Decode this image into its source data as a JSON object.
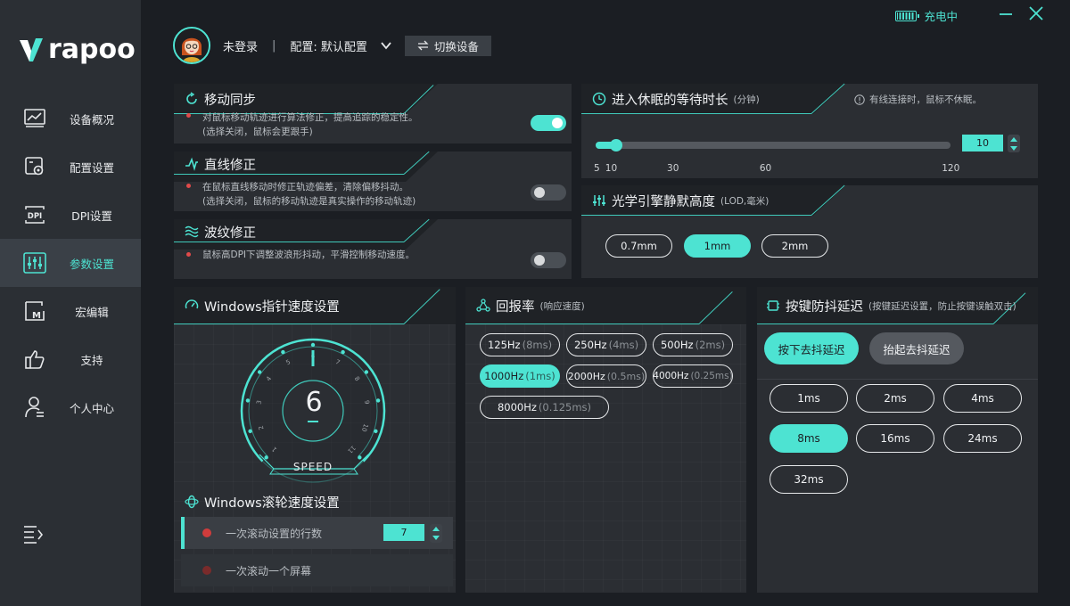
{
  "brand": {
    "name": "rapoo"
  },
  "colors": {
    "accent": "#4de3d2",
    "panel": "#2b2e33",
    "sidebar": "#2b2f34",
    "alert_dot": "#e04a4a"
  },
  "window": {
    "battery_status": "充电中",
    "minimize_icon": "minimize-icon",
    "close_icon": "close-icon"
  },
  "header": {
    "login_status": "未登录",
    "separator": "|",
    "config_label": "配置: 默认配置",
    "switch_device": "切换设备"
  },
  "sidebar": {
    "items": [
      {
        "label": "设备概况",
        "icon": "monitor-chart-icon",
        "active": false
      },
      {
        "label": "配置设置",
        "icon": "config-gear-icon",
        "active": false
      },
      {
        "label": "DPI设置",
        "icon": "dpi-icon",
        "active": false
      },
      {
        "label": "参数设置",
        "icon": "sliders-icon",
        "active": true
      },
      {
        "label": "宏编辑",
        "icon": "macro-icon",
        "active": false
      },
      {
        "label": "支持",
        "icon": "thumbs-up-icon",
        "active": false
      },
      {
        "label": "个人中心",
        "icon": "user-icon",
        "active": false
      }
    ]
  },
  "motion_sync": {
    "title": "移动同步",
    "desc1": "对鼠标移动轨迹进行算法修正，提高追踪的稳定性。",
    "desc2": "(选择关闭，鼠标会更跟手)",
    "enabled": true
  },
  "angle_snap": {
    "title": "直线修正",
    "desc1": "在鼠标直线移动时修正轨迹偏差，清除偏移抖动。",
    "desc2": "(选择关闭，鼠标的移动轨迹是真实操作的移动轨迹)",
    "enabled": false
  },
  "ripple": {
    "title": "波纹修正",
    "desc1": "鼠标高DPI下调整波浪形抖动，平滑控制移动速度。",
    "enabled": false
  },
  "sleep": {
    "title": "进入休眠的等待时长",
    "unit": "(分钟)",
    "note": "有线连接时，鼠标不休眠。",
    "value": "10",
    "min": 5,
    "max": 120,
    "ticks": [
      "5",
      "10",
      "30",
      "60",
      "120"
    ]
  },
  "lod": {
    "title": "光学引擎静默高度",
    "unit": "(LOD,毫米)",
    "options": [
      "0.7mm",
      "1mm",
      "2mm"
    ],
    "selected": 1
  },
  "pointer_speed": {
    "title": "Windows指针速度设置",
    "value": "6",
    "speed_label": "SPEED",
    "dial_numbers": [
      "1",
      "2",
      "3",
      "4",
      "5",
      "6",
      "7",
      "8",
      "9",
      "10",
      "11"
    ],
    "level": 6,
    "max": 11
  },
  "scroll": {
    "title": "Windows滚轮速度设置",
    "rows_label": "一次滚动设置的行数",
    "rows_value": "7",
    "screen_label": "一次滚动一个屏幕"
  },
  "polling": {
    "title": "回报率",
    "subtitle": "(响应速度)",
    "options": [
      {
        "rate": "125Hz",
        "delay": "(8ms)"
      },
      {
        "rate": "250Hz",
        "delay": "(4ms)"
      },
      {
        "rate": "500Hz",
        "delay": "(2ms)"
      },
      {
        "rate": "1000Hz",
        "delay": "(1ms)"
      },
      {
        "rate": "2000Hz",
        "delay": "(0.5ms)"
      },
      {
        "rate": "4000Hz",
        "delay": "(0.25ms)"
      },
      {
        "rate": "8000Hz",
        "delay": "(0.125ms)"
      }
    ],
    "selected": 3
  },
  "debounce": {
    "title": "按键防抖延迟",
    "subtitle": "(按键延迟设置，防止按键误触双击)",
    "press_label": "按下去抖延迟",
    "release_label": "抬起去抖延迟",
    "options": [
      "1ms",
      "2ms",
      "4ms",
      "8ms",
      "16ms",
      "24ms",
      "32ms"
    ],
    "selected": 3
  }
}
